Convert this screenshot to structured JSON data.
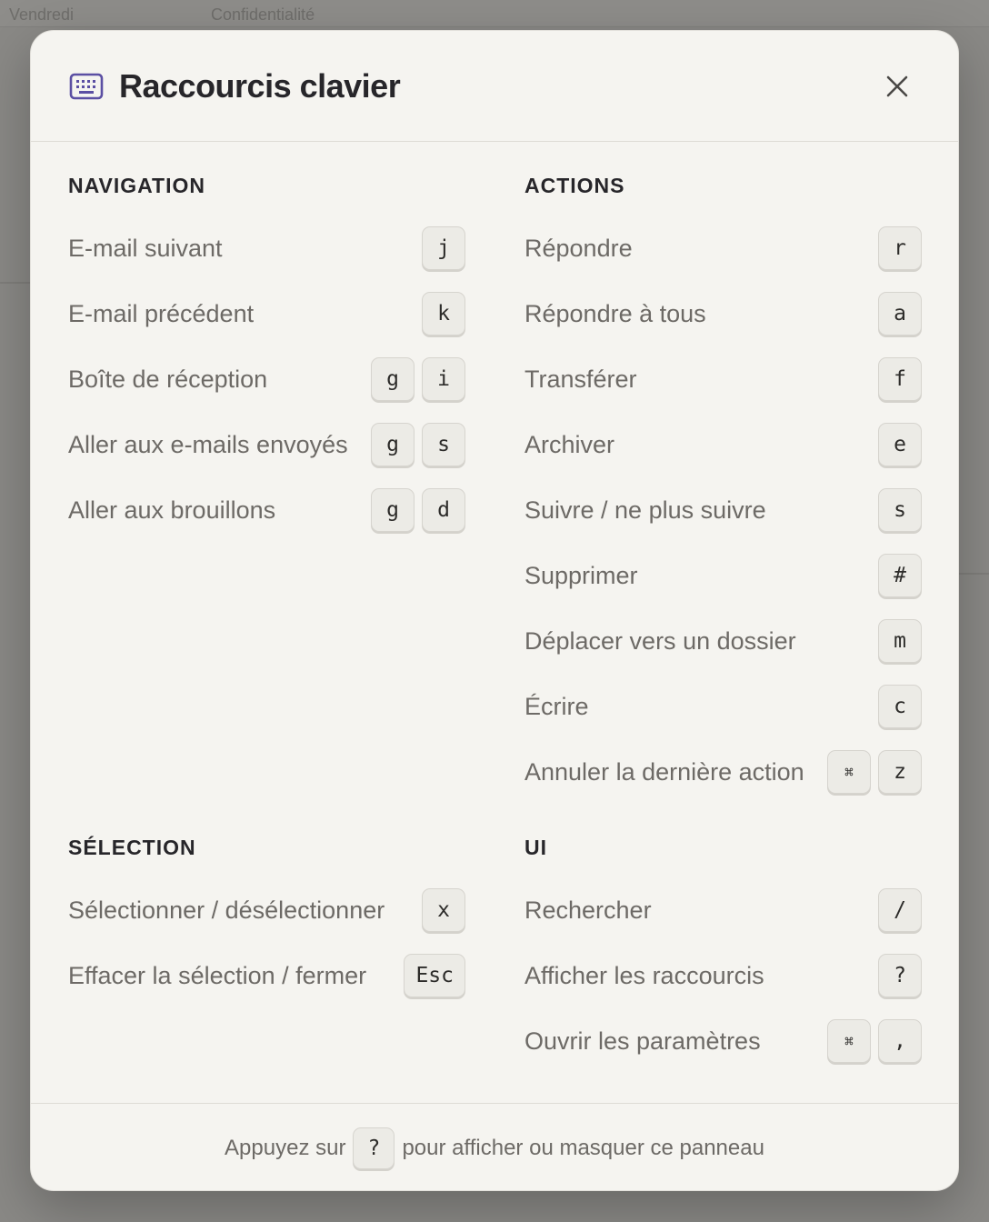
{
  "background": {
    "left_text": "Vendredi",
    "right_text": "Confidentialité"
  },
  "modal": {
    "title": "Raccourcis clavier",
    "close_icon": "close-icon",
    "header_icon": "keyboard-icon"
  },
  "sections": {
    "navigation": {
      "title": "NAVIGATION",
      "items": [
        {
          "label": "E-mail suivant",
          "keys": [
            "j"
          ]
        },
        {
          "label": "E-mail précédent",
          "keys": [
            "k"
          ]
        },
        {
          "label": "Boîte de réception",
          "keys": [
            "g",
            "i"
          ]
        },
        {
          "label": "Aller aux e-mails envoyés",
          "keys": [
            "g",
            "s"
          ]
        },
        {
          "label": "Aller aux brouillons",
          "keys": [
            "g",
            "d"
          ]
        }
      ]
    },
    "actions": {
      "title": "ACTIONS",
      "items": [
        {
          "label": "Répondre",
          "keys": [
            "r"
          ]
        },
        {
          "label": "Répondre à tous",
          "keys": [
            "a"
          ]
        },
        {
          "label": "Transférer",
          "keys": [
            "f"
          ]
        },
        {
          "label": "Archiver",
          "keys": [
            "e"
          ]
        },
        {
          "label": "Suivre / ne plus suivre",
          "keys": [
            "s"
          ]
        },
        {
          "label": "Supprimer",
          "keys": [
            "#"
          ]
        },
        {
          "label": "Déplacer vers un dossier",
          "keys": [
            "m"
          ]
        },
        {
          "label": "Écrire",
          "keys": [
            "c"
          ]
        },
        {
          "label": "Annuler la dernière action",
          "keys": [
            "⌘",
            "z"
          ]
        }
      ]
    },
    "selection": {
      "title": "SÉLECTION",
      "items": [
        {
          "label": "Sélectionner / désélectionner",
          "keys": [
            "x"
          ]
        },
        {
          "label": "Effacer la sélection / fermer",
          "keys": [
            "Esc"
          ]
        }
      ]
    },
    "ui": {
      "title": "UI",
      "items": [
        {
          "label": "Rechercher",
          "keys": [
            "/"
          ]
        },
        {
          "label": "Afficher les raccourcis",
          "keys": [
            "?"
          ]
        },
        {
          "label": "Ouvrir les paramètres",
          "keys": [
            "⌘",
            ","
          ]
        }
      ]
    }
  },
  "footer": {
    "before": "Appuyez sur",
    "key": "?",
    "after": "pour afficher ou masquer ce panneau"
  },
  "colors": {
    "accent": "#5b4fa3",
    "text": "#27262a",
    "muted": "#6d6a66"
  }
}
